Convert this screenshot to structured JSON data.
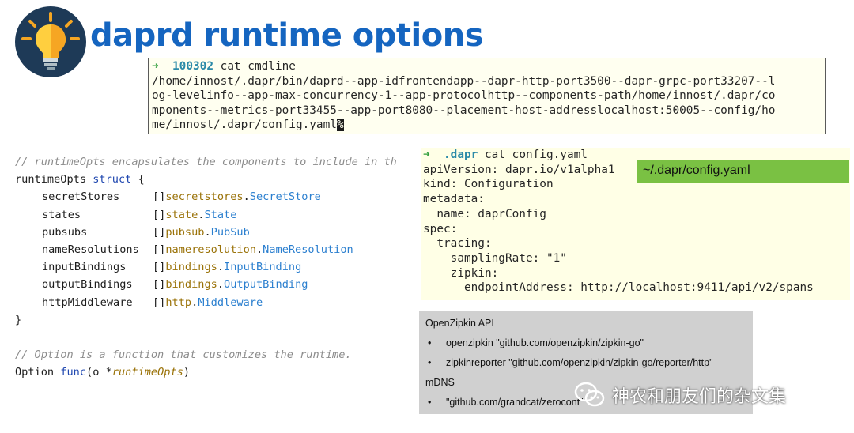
{
  "slide": {
    "title": "daprd runtime options",
    "logo_icon": "lightbulb-icon"
  },
  "terminal_cmdline": {
    "prompt_arrow": "➜",
    "prompt_dir": "100302",
    "command": "cat cmdline",
    "output_lines": [
      "/home/innost/.dapr/bin/daprd--app-idfrontendapp--dapr-http-port3500--dapr-grpc-port33207--l",
      "og-levelinfo--app-max-concurrency-1--app-protocolhttp--components-path/home/innost/.dapr/co",
      "mponents--metrics-port33455--app-port8080--placement-host-addresslocalhost:50005--config/ho"
    ],
    "last_line": "me/innost/.dapr/config.yaml",
    "cursor_char": "%"
  },
  "code": {
    "comment1": "// runtimeOpts encapsulates the components to include in th",
    "struct_name": "runtimeOpts",
    "struct_kw": "struct",
    "open_brace": "{",
    "close_brace": "}",
    "fields": [
      {
        "name": "secretStores",
        "prefix": "[]",
        "pkg": "secretstores",
        "type": "SecretStore"
      },
      {
        "name": "states",
        "prefix": "[]",
        "pkg": "state",
        "type": "State"
      },
      {
        "name": "pubsubs",
        "prefix": "[]",
        "pkg": "pubsub",
        "type": "PubSub"
      },
      {
        "name": "nameResolutions",
        "prefix": "[]",
        "pkg": "nameresolution",
        "type": "NameResolution"
      },
      {
        "name": "inputBindings",
        "prefix": "[]",
        "pkg": "bindings",
        "type": "InputBinding"
      },
      {
        "name": "outputBindings",
        "prefix": "[]",
        "pkg": "bindings",
        "type": "OutputBinding"
      },
      {
        "name": "httpMiddleware",
        "prefix": "[]",
        "pkg": "http",
        "type": "Middleware"
      }
    ],
    "comment2": "// Option is a function that customizes the runtime.",
    "option_name": "Option",
    "func_kw": "func",
    "func_param_open": "(o *",
    "func_param_type": "runtimeOpts",
    "func_param_close": ")"
  },
  "terminal_config": {
    "prompt_arrow": "➜",
    "prompt_dir": ".dapr",
    "command": "cat config.yaml",
    "lines": [
      "apiVersion: dapr.io/v1alpha1",
      "kind: Configuration",
      "metadata:",
      "  name: daprConfig",
      "spec:",
      "  tracing:",
      "    samplingRate: \"1\"",
      "    zipkin:",
      "      endpointAddress: http://localhost:9411/api/v2/spans"
    ]
  },
  "path_badge": "~/.dapr/config.yaml",
  "info_box": {
    "heading1": "OpenZipkin API",
    "items1": [
      "openzipkin \"github.com/openzipkin/zipkin-go\"",
      "zipkinreporter \"github.com/openzipkin/zipkin-go/reporter/http\""
    ],
    "heading2": "mDNS",
    "items2": [
      "\"github.com/grandcat/zeroconf\""
    ],
    "bullet": "•"
  },
  "watermark": {
    "icon": "wechat-icon",
    "text": "神农和朋友们的杂文集"
  }
}
